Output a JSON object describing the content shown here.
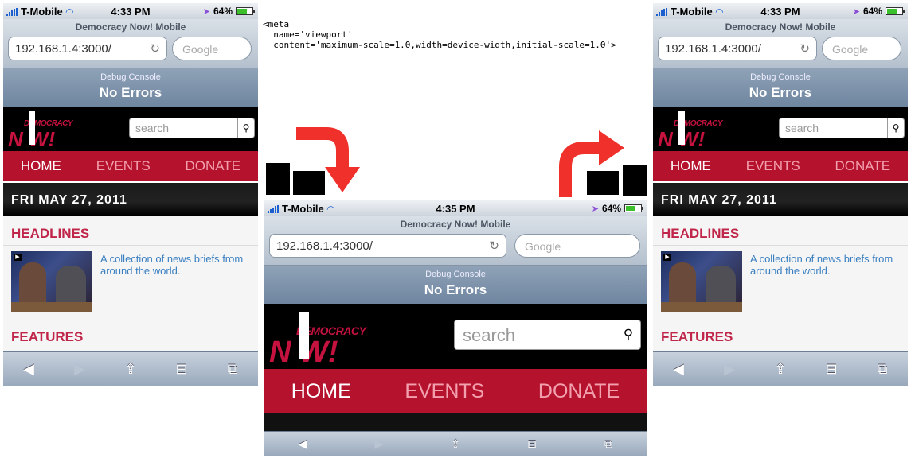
{
  "code_snippet": "<meta\n  name='viewport'\n  content='maximum-scale=1.0,width=device-width,initial-scale=1.0'>",
  "phones": {
    "left": {
      "status": {
        "carrier": "T-Mobile",
        "time": "4:33 PM",
        "battery": "64%"
      },
      "safari": {
        "title": "Democracy Now! Mobile",
        "url": "192.168.1.4:3000/",
        "search_placeholder": "Google"
      },
      "debug": {
        "title": "Debug Console",
        "message": "No Errors"
      },
      "site": {
        "logo_top": "DEMOCRACY",
        "logo_bottom": "N W!",
        "search_placeholder": "search",
        "nav": [
          "HOME",
          "EVENTS",
          "DONATE"
        ],
        "date": "FRI MAY 27, 2011",
        "headlines": "HEADLINES",
        "blurb": "A collection of news briefs from around the world.",
        "features": "FEATURES"
      }
    },
    "middle": {
      "status": {
        "carrier": "T-Mobile",
        "time": "4:35 PM",
        "battery": "64%"
      },
      "safari": {
        "title": "Democracy Now! Mobile",
        "url": "192.168.1.4:3000/",
        "search_placeholder": "Google"
      },
      "debug": {
        "title": "Debug Console",
        "message": "No Errors"
      },
      "site": {
        "logo_top": "DEMOCRACY",
        "logo_bottom": "N W!",
        "search_placeholder": "search",
        "nav": [
          "HOME",
          "EVENTS",
          "DONATE"
        ]
      }
    },
    "right": {
      "status": {
        "carrier": "T-Mobile",
        "time": "4:33 PM",
        "battery": "64%"
      },
      "safari": {
        "title": "Democracy Now! Mobile",
        "url": "192.168.1.4:3000/",
        "search_placeholder": "Google"
      },
      "debug": {
        "title": "Debug Console",
        "message": "No Errors"
      },
      "site": {
        "logo_top": "DEMOCRACY",
        "logo_bottom": "N W!",
        "search_placeholder": "search",
        "nav": [
          "HOME",
          "EVENTS",
          "DONATE"
        ],
        "date": "FRI MAY 27, 2011",
        "headlines": "HEADLINES",
        "blurb": "A collection of news briefs from around the world.",
        "features": "FEATURES"
      }
    }
  },
  "icons": {
    "back": "back-arrow-icon",
    "forward": "forward-arrow-icon",
    "share": "share-icon",
    "bookmarks": "bookmarks-icon",
    "pages": "pages-icon",
    "reload": "reload-icon",
    "search": "magnifier-icon",
    "rotate_arrow": "rotate-arrow-icon"
  },
  "colors": {
    "brand_red": "#b5122d",
    "logo_red": "#c5123e",
    "link_blue": "#3a7fc0",
    "arrow_red": "#f0302a"
  }
}
